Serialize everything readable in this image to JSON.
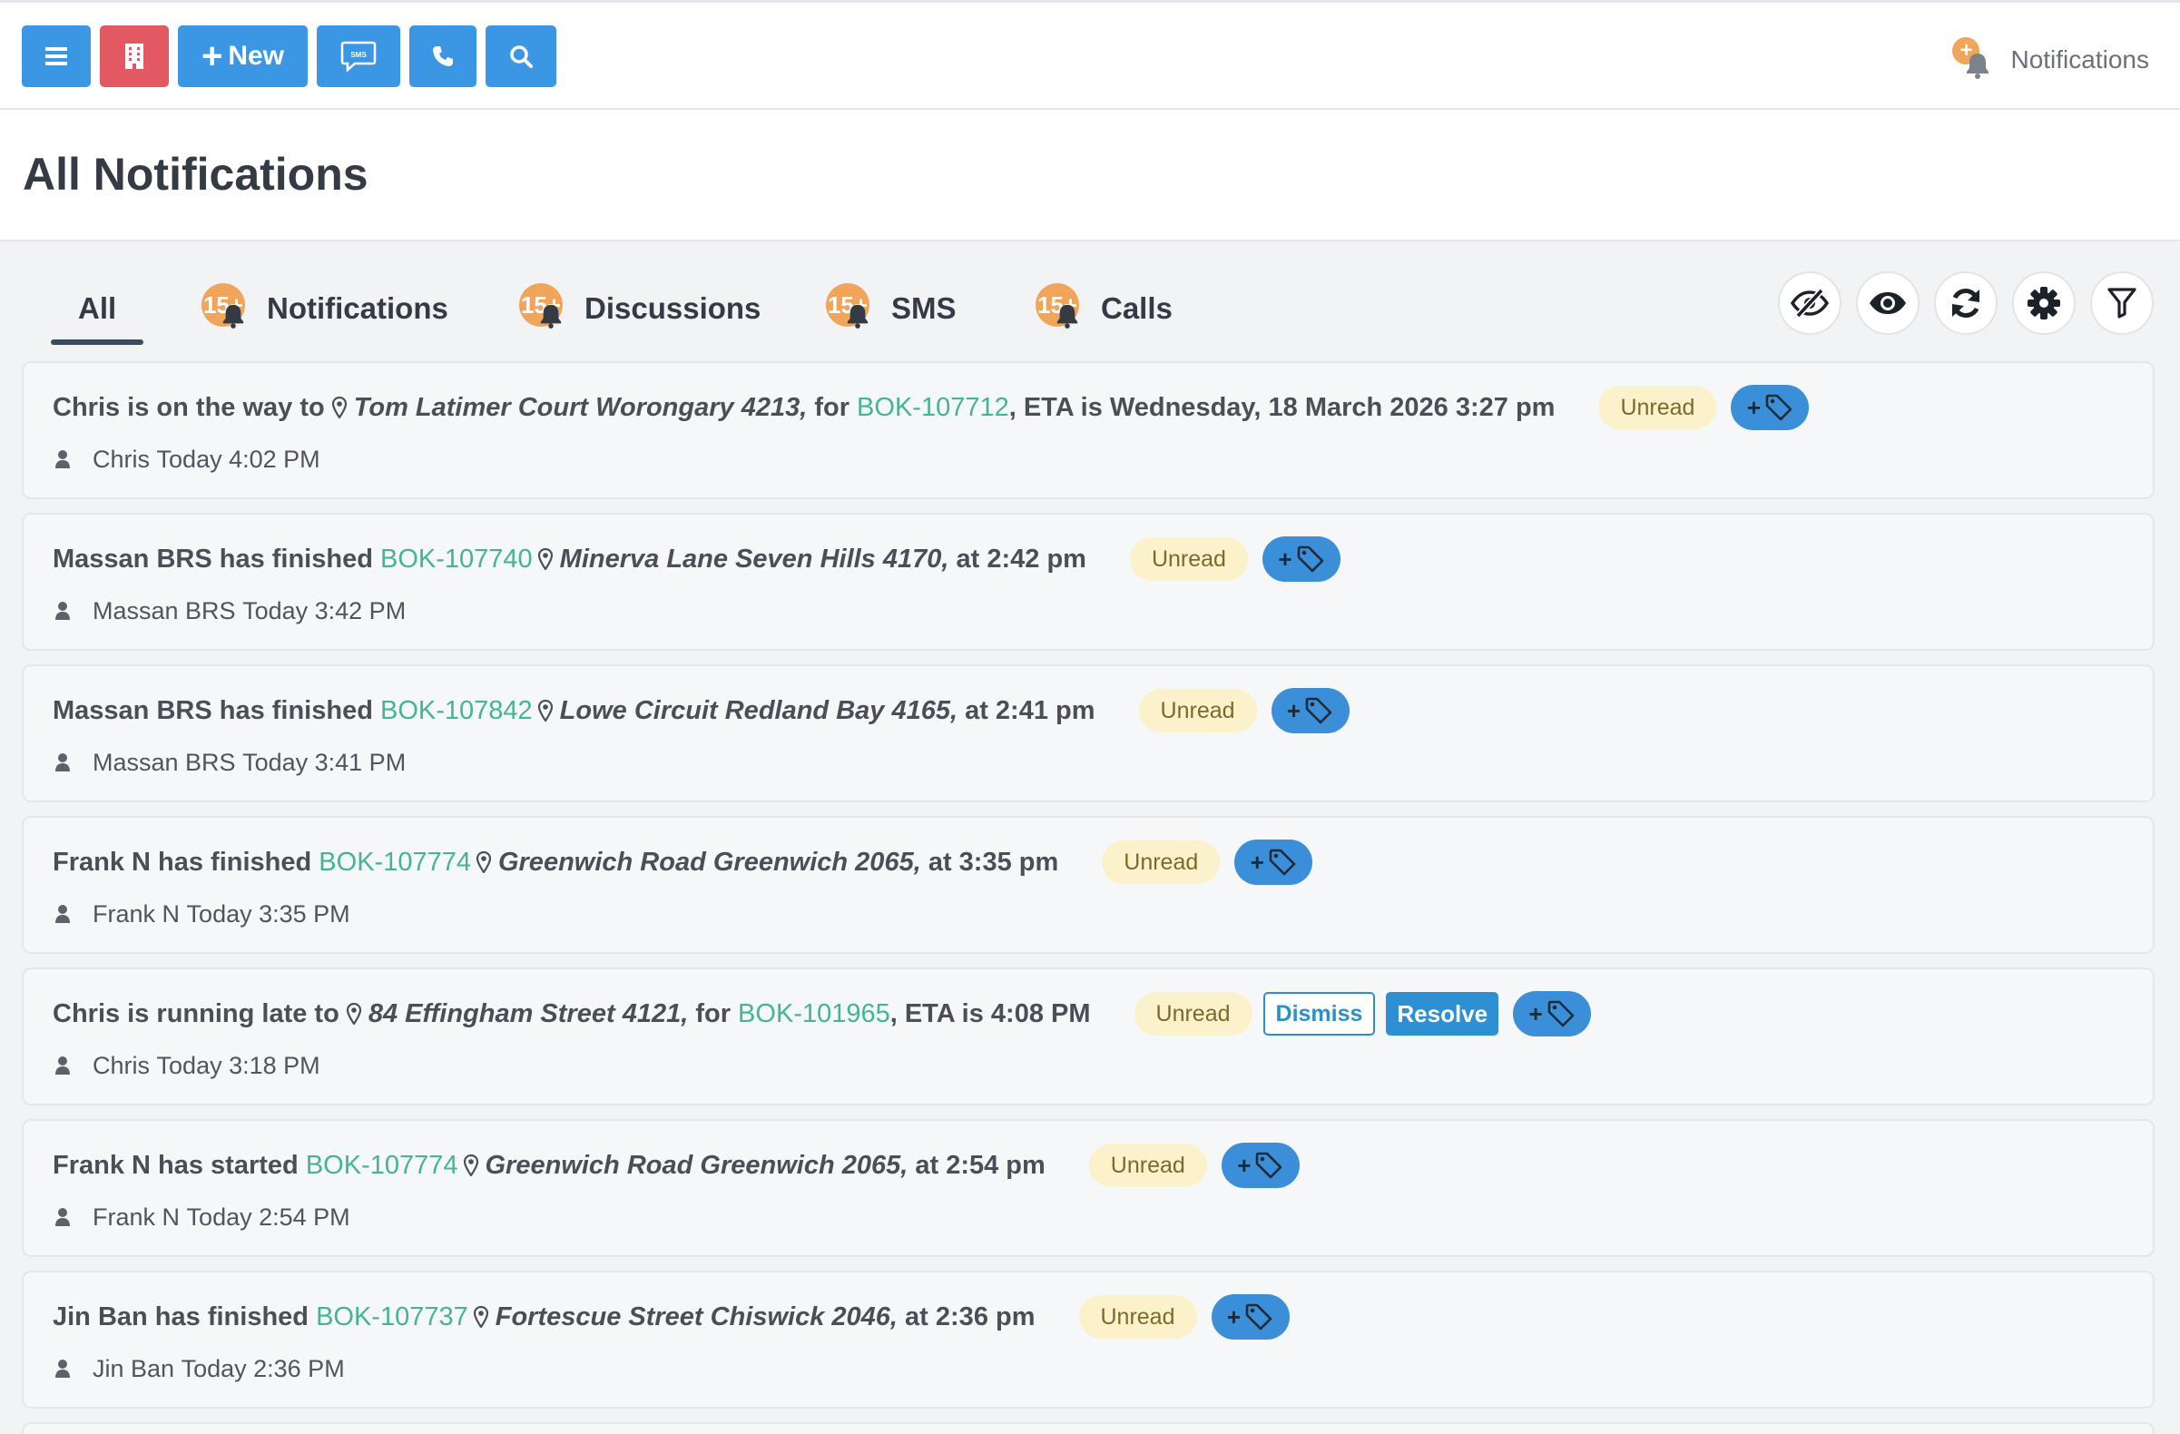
{
  "toolbar": {
    "menu_icon": "bars-icon",
    "building_icon": "building-icon",
    "new_label": "New",
    "sms_icon": "sms-icon",
    "phone_icon": "phone-icon",
    "search_icon": "search-icon",
    "notifications_label": "Notifications",
    "notifications_badge": "+"
  },
  "page": {
    "title": "All Notifications"
  },
  "tabs": [
    {
      "label": "All",
      "active": true
    },
    {
      "label": "Notifications",
      "badge": "15+"
    },
    {
      "label": "Discussions",
      "badge": "15+"
    },
    {
      "label": "SMS",
      "badge": "15+"
    },
    {
      "label": "Calls",
      "badge": "15+"
    }
  ],
  "tab_actions": [
    "eye-slash-icon",
    "eye-icon",
    "refresh-icon",
    "gear-icon",
    "filter-icon"
  ],
  "notifications": [
    {
      "pre": "Chris is on the way to",
      "address": "Tom Latimer Court Worongary 4213,",
      "mid": " for ",
      "booking": "BOK-107712",
      "post": ", ETA is Wednesday, 18 March 2026 3:27 pm",
      "user": "Chris",
      "time": "Today 4:02 PM",
      "status": "Unread"
    },
    {
      "pre": "Massan BRS has finished ",
      "booking": "BOK-107740",
      "address": "Minerva Lane Seven Hills 4170,",
      "post": " at 2:42 pm",
      "user": "Massan BRS",
      "time": "Today 3:42 PM",
      "status": "Unread"
    },
    {
      "pre": "Massan BRS has finished ",
      "booking": "BOK-107842",
      "address": "Lowe Circuit Redland Bay 4165,",
      "post": " at 2:41 pm",
      "user": "Massan BRS",
      "time": "Today 3:41 PM",
      "status": "Unread"
    },
    {
      "pre": "Frank N has finished ",
      "booking": "BOK-107774",
      "address": "Greenwich Road Greenwich 2065,",
      "post": " at 3:35 pm",
      "user": "Frank N",
      "time": "Today 3:35 PM",
      "status": "Unread"
    },
    {
      "pre": "Chris is running late to",
      "address": "84 Effingham Street 4121,",
      "mid": " for ",
      "booking": "BOK-101965",
      "post": ", ETA is 4:08 PM",
      "user": "Chris",
      "time": "Today 3:18 PM",
      "status": "Unread",
      "dismiss_label": "Dismiss",
      "resolve_label": "Resolve"
    },
    {
      "pre": "Frank N has started ",
      "booking": "BOK-107774",
      "address": "Greenwich Road Greenwich 2065,",
      "post": " at 2:54 pm",
      "user": "Frank N",
      "time": "Today 2:54 PM",
      "status": "Unread"
    },
    {
      "pre": "Jin Ban has finished ",
      "booking": "BOK-107737",
      "address": "Fortescue Street Chiswick 2046,",
      "post": " at 2:36 pm",
      "user": "Jin Ban",
      "time": "Today 2:36 PM",
      "status": "Unread"
    }
  ],
  "tag_button_label": "+",
  "colors": {
    "primary": "#3b97e3",
    "danger": "#e25863",
    "link": "#45b394",
    "unread_bg": "#fbf2cc",
    "badge": "#f0a55a"
  }
}
